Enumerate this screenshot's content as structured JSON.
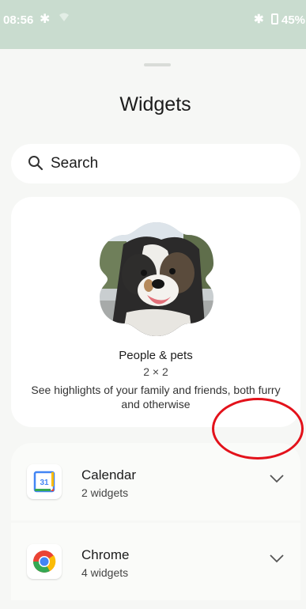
{
  "status_bar": {
    "time": "08:56",
    "battery": "45%"
  },
  "sheet": {
    "title": "Widgets",
    "search": {
      "label": "Search"
    }
  },
  "preview": {
    "name": "People & pets",
    "size": "2 × 2",
    "description": "See highlights of your family and friends, both furry and otherwise"
  },
  "apps": [
    {
      "name": "Calendar",
      "count": "2 widgets",
      "icon": "calendar-app-icon",
      "icon_text": "31"
    },
    {
      "name": "Chrome",
      "count": "4 widgets",
      "icon": "chrome-app-icon"
    }
  ],
  "colors": {
    "status_bar_bg": "#c9dccf",
    "annotation": "#e3121b",
    "calendar_blue": "#4285f4",
    "chrome_red": "#ea4335",
    "chrome_yellow": "#fbbc05",
    "chrome_green": "#34a853"
  }
}
